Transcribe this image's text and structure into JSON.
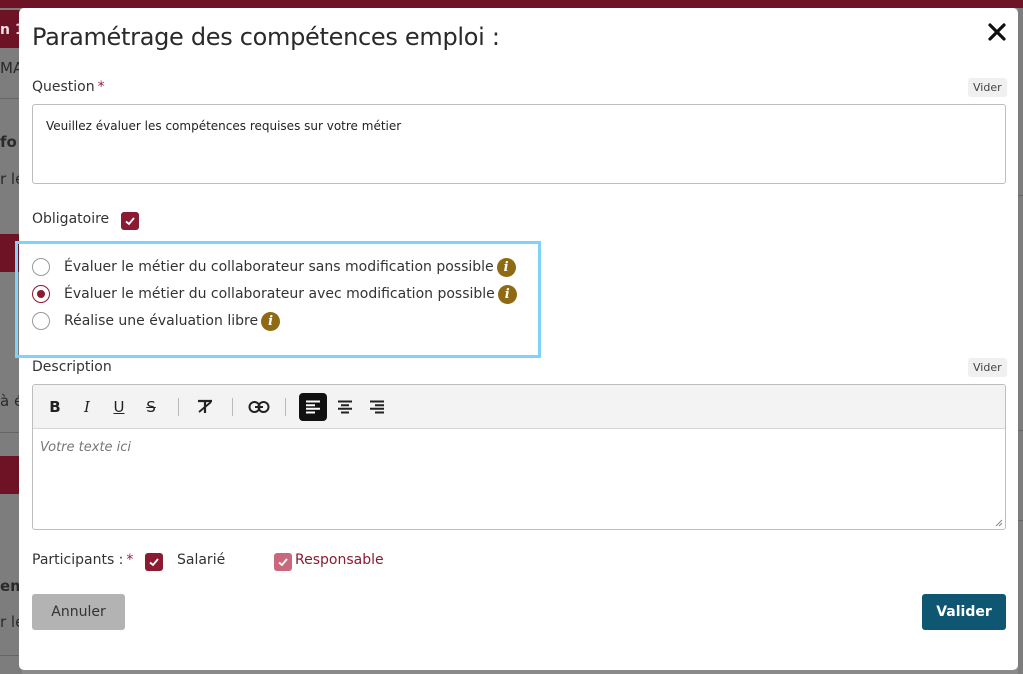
{
  "background": {
    "fragments": [
      "n 1",
      "MA",
      "fo",
      "r le",
      "à é",
      "em",
      "r le"
    ]
  },
  "modal": {
    "title": "Paramétrage des compétences emploi :",
    "close_icon": "close-icon"
  },
  "question": {
    "label": "Question",
    "required_mark": "*",
    "clear_label": "Vider",
    "value": "Veuillez évaluer les compétences requises sur votre métier"
  },
  "mandatory": {
    "label": "Obligatoire",
    "checked": true
  },
  "evaluation_options": [
    {
      "label": "Évaluer le métier du collaborateur sans modification possible",
      "selected": false,
      "info_icon": "info-icon"
    },
    {
      "label": "Évaluer le métier du collaborateur avec modification possible",
      "selected": true,
      "info_icon": "info-icon"
    },
    {
      "label": "Réalise une évaluation libre",
      "selected": false,
      "info_icon": "info-icon"
    }
  ],
  "description": {
    "label": "Description",
    "clear_label": "Vider",
    "placeholder": "Votre texte ici",
    "toolbar": {
      "bold": "B",
      "italic": "I",
      "underline": "U",
      "strikethrough": "S",
      "icons": [
        "bold-icon",
        "italic-icon",
        "underline-icon",
        "strikethrough-icon",
        "clear-format-icon",
        "link-icon",
        "align-left-icon",
        "align-center-icon",
        "align-right-icon"
      ]
    }
  },
  "participants": {
    "label": "Participants :",
    "required_mark": "*",
    "options": [
      {
        "label": "Salarié",
        "checked": true
      },
      {
        "label": "Responsable",
        "checked": true
      }
    ]
  },
  "actions": {
    "cancel_label": "Annuler",
    "submit_label": "Valider"
  },
  "colors": {
    "accent": "#8b1a33",
    "primary_button": "#0f5673",
    "info": "#8f6a14",
    "highlight": "#7fd3f7"
  }
}
